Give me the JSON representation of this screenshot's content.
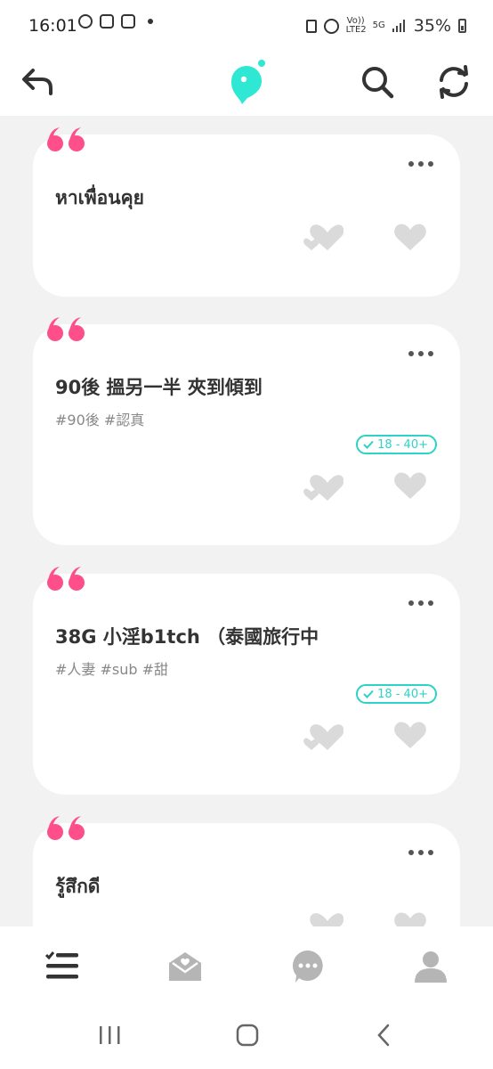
{
  "status_bar": {
    "time": "16:01",
    "network": "5G",
    "volte": "Vo)) LTE2",
    "battery_percent": "35%"
  },
  "header": {
    "back_icon": "back-arrow-icon",
    "logo_icon": "app-logo-icon",
    "search_icon": "search-icon",
    "refresh_icon": "refresh-icon",
    "accent_color": "#2ee8d4"
  },
  "posts": [
    {
      "title": "หาเพื่อนคุย",
      "tags": "",
      "age_range": ""
    },
    {
      "title": "90後 搵另一半 夾到傾到",
      "tags": "#90後 #認真",
      "age_range": "18 - 40+"
    },
    {
      "title": "38G 小淫b1tch （泰國旅行中",
      "tags": "#人妻 #sub #甜",
      "age_range": "18 - 40+"
    },
    {
      "title": "รู้สึกดี",
      "tags": "",
      "age_range": ""
    }
  ],
  "bottom_nav": {
    "items": [
      "list-icon",
      "mail-icon",
      "chat-icon",
      "profile-icon"
    ]
  },
  "colors": {
    "quote_pink": "#ff4f8b",
    "badge_teal": "#2dd3c5",
    "like_gray": "#dadada"
  }
}
